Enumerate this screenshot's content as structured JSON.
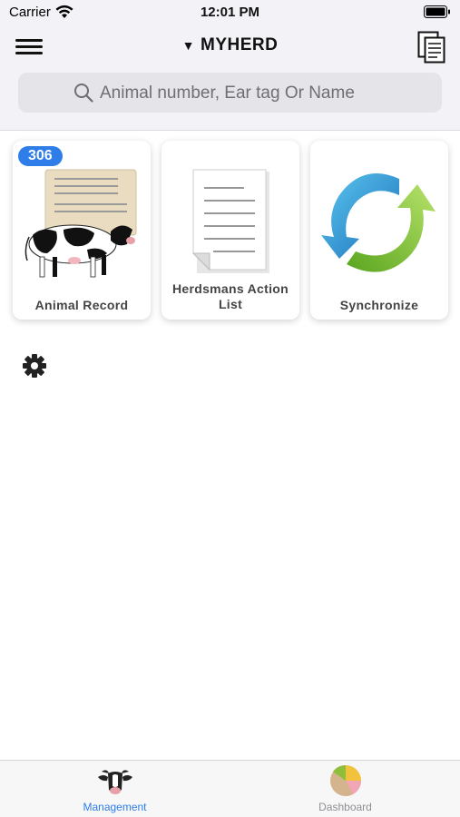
{
  "status_bar": {
    "carrier": "Carrier",
    "time": "12:01 PM"
  },
  "nav": {
    "herd_name": "MYHERD",
    "search_placeholder": "Animal number, Ear tag Or Name"
  },
  "tiles": [
    {
      "label": "Animal Record",
      "badge": "306",
      "icon": "cow-record-icon"
    },
    {
      "label": "Herdsmans Action List",
      "icon": "document-icon"
    },
    {
      "label": "Synchronize",
      "icon": "sync-icon"
    }
  ],
  "tab_bar": {
    "tabs": [
      {
        "label": "Management",
        "icon": "cow-head-icon",
        "active": true
      },
      {
        "label": "Dashboard",
        "icon": "pie-chart-icon",
        "active": false
      }
    ]
  },
  "colors": {
    "accent": "#2f7de9",
    "inactive_tab": "#8e8e93",
    "badge_bg": "#2f7de9"
  }
}
